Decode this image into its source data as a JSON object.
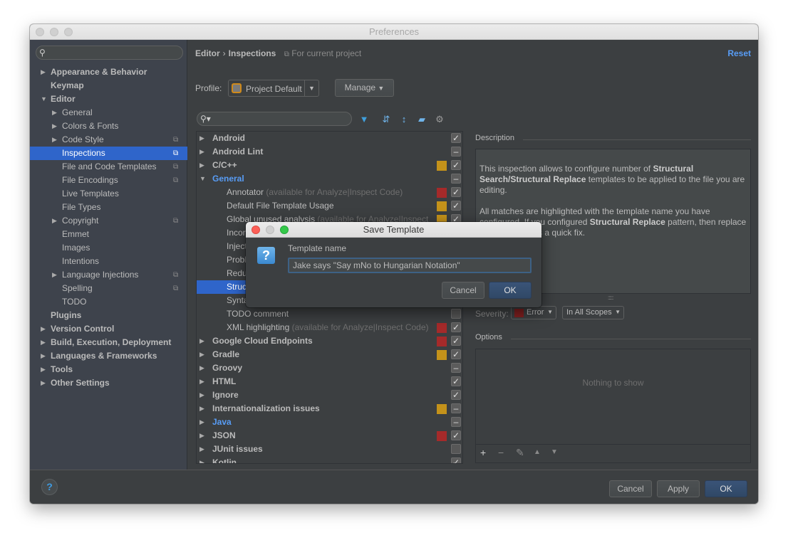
{
  "window": {
    "title": "Preferences"
  },
  "sidebar": {
    "search_placeholder": "",
    "items": [
      {
        "label": "Appearance & Behavior",
        "level": 0,
        "arrow": "right",
        "bold": true
      },
      {
        "label": "Keymap",
        "level": 0,
        "arrow": "",
        "bold": true
      },
      {
        "label": "Editor",
        "level": 0,
        "arrow": "down",
        "bold": true
      },
      {
        "label": "General",
        "level": 1,
        "arrow": "right"
      },
      {
        "label": "Colors & Fonts",
        "level": 1,
        "arrow": "right"
      },
      {
        "label": "Code Style",
        "level": 1,
        "arrow": "right",
        "project": true
      },
      {
        "label": "Inspections",
        "level": 1,
        "arrow": "",
        "project": true,
        "selected": true
      },
      {
        "label": "File and Code Templates",
        "level": 1,
        "arrow": "",
        "project": true
      },
      {
        "label": "File Encodings",
        "level": 1,
        "arrow": "",
        "project": true
      },
      {
        "label": "Live Templates",
        "level": 1,
        "arrow": ""
      },
      {
        "label": "File Types",
        "level": 1,
        "arrow": ""
      },
      {
        "label": "Copyright",
        "level": 1,
        "arrow": "right",
        "project": true
      },
      {
        "label": "Emmet",
        "level": 1,
        "arrow": ""
      },
      {
        "label": "Images",
        "level": 1,
        "arrow": ""
      },
      {
        "label": "Intentions",
        "level": 1,
        "arrow": ""
      },
      {
        "label": "Language Injections",
        "level": 1,
        "arrow": "right",
        "project": true
      },
      {
        "label": "Spelling",
        "level": 1,
        "arrow": "",
        "project": true
      },
      {
        "label": "TODO",
        "level": 1,
        "arrow": ""
      },
      {
        "label": "Plugins",
        "level": 0,
        "arrow": "",
        "bold": true
      },
      {
        "label": "Version Control",
        "level": 0,
        "arrow": "right",
        "bold": true
      },
      {
        "label": "Build, Execution, Deployment",
        "level": 0,
        "arrow": "right",
        "bold": true
      },
      {
        "label": "Languages & Frameworks",
        "level": 0,
        "arrow": "right",
        "bold": true
      },
      {
        "label": "Tools",
        "level": 0,
        "arrow": "right",
        "bold": true
      },
      {
        "label": "Other Settings",
        "level": 0,
        "arrow": "right",
        "bold": true
      }
    ]
  },
  "header": {
    "breadcrumb": [
      "Editor",
      "Inspections"
    ],
    "breadcrumb_sep": "›",
    "scope_note": "For current project",
    "reset_label": "Reset"
  },
  "profile": {
    "label": "Profile:",
    "value": "Project Default",
    "manage_label": "Manage"
  },
  "filter": {
    "placeholder": ""
  },
  "colors": {
    "error": "#a52a2a",
    "warning": "#c4921a",
    "accent": "#589df6",
    "selection": "#2f65ca"
  },
  "inspections": [
    {
      "label": "Android",
      "level": 0,
      "arrow": "right",
      "bold": true,
      "severity": "",
      "check": "checked"
    },
    {
      "label": "Android Lint",
      "level": 0,
      "arrow": "right",
      "bold": true,
      "severity": "",
      "check": "partial"
    },
    {
      "label": "C/C++",
      "level": 0,
      "arrow": "right",
      "bold": true,
      "severity": "warning",
      "check": "checked"
    },
    {
      "label": "General",
      "level": 0,
      "arrow": "down",
      "bold": true,
      "blue": true,
      "severity": "",
      "check": "partial"
    },
    {
      "label": "Annotator",
      "hint": " (available for Analyze|Inspect Code)",
      "level": 1,
      "severity": "error",
      "check": "checked"
    },
    {
      "label": "Default File Template Usage",
      "level": 1,
      "severity": "warning",
      "check": "checked"
    },
    {
      "label": "Global unused analysis",
      "hint": " (available for Analyze|Inspect",
      "level": 1,
      "severity": "warning",
      "check": "checked"
    },
    {
      "label": "Inconsistent line separators",
      "level": 1,
      "severity": "",
      "check": ""
    },
    {
      "label": "Injected",
      "level": 1,
      "severity": "",
      "check": ""
    },
    {
      "label": "Problematic",
      "level": 1,
      "severity": "",
      "check": ""
    },
    {
      "label": "Redundant",
      "level": 1,
      "severity": "",
      "check": ""
    },
    {
      "label": "Structural Search Inspection",
      "level": 1,
      "severity": "",
      "check": "",
      "selected": true
    },
    {
      "label": "Syntax",
      "level": 1,
      "severity": "",
      "check": ""
    },
    {
      "label": "TODO comment",
      "level": 1,
      "severity": "",
      "check": "empty"
    },
    {
      "label": "XML highlighting",
      "hint": " (available for Analyze|Inspect Code)",
      "level": 1,
      "severity": "error",
      "check": "checked"
    },
    {
      "label": "Google Cloud Endpoints",
      "level": 0,
      "arrow": "right",
      "bold": true,
      "severity": "error",
      "check": "checked"
    },
    {
      "label": "Gradle",
      "level": 0,
      "arrow": "right",
      "bold": true,
      "severity": "warning",
      "check": "checked"
    },
    {
      "label": "Groovy",
      "level": 0,
      "arrow": "right",
      "bold": true,
      "severity": "",
      "check": "partial"
    },
    {
      "label": "HTML",
      "level": 0,
      "arrow": "right",
      "bold": true,
      "severity": "",
      "check": "checked"
    },
    {
      "label": "Ignore",
      "level": 0,
      "arrow": "right",
      "bold": true,
      "severity": "",
      "check": "checked"
    },
    {
      "label": "Internationalization issues",
      "level": 0,
      "arrow": "right",
      "bold": true,
      "severity": "warning",
      "check": "partial"
    },
    {
      "label": "Java",
      "level": 0,
      "arrow": "right",
      "bold": true,
      "blue": true,
      "severity": "",
      "check": "partial"
    },
    {
      "label": "JSON",
      "level": 0,
      "arrow": "right",
      "bold": true,
      "severity": "error",
      "check": "checked"
    },
    {
      "label": "JUnit issues",
      "level": 0,
      "arrow": "right",
      "bold": true,
      "severity": "",
      "check": "empty"
    },
    {
      "label": "Kotlin",
      "level": 0,
      "arrow": "right",
      "bold": true,
      "severity": "",
      "check": "checked"
    }
  ],
  "description": {
    "title": "Description",
    "p1_a": "This inspection allows to configure number of ",
    "p1_b": "Structural Search/Structural Replace",
    "p1_c": " templates to be applied to the file you are editing.",
    "p2_a": "All matches are highlighted with the template name you have configured. If you configured ",
    "p2_b": "Structural Replace",
    "p2_c": " pattern, then replace would appear as a quick fix."
  },
  "severity": {
    "label": "Severity:",
    "value": "Error",
    "scope_value": "In All Scopes"
  },
  "options": {
    "title": "Options",
    "empty_text": "Nothing to show",
    "tools": [
      "+",
      "−",
      "✎",
      "▲",
      "▼"
    ]
  },
  "footer": {
    "help": "?",
    "cancel_label": "Cancel",
    "apply_label": "Apply",
    "ok_label": "OK"
  },
  "dialog": {
    "title": "Save Template",
    "field_label": "Template name",
    "field_value": "Jake says \"Say mNo to Hungarian Notation\"",
    "cancel_label": "Cancel",
    "ok_label": "OK",
    "icon": "?"
  }
}
